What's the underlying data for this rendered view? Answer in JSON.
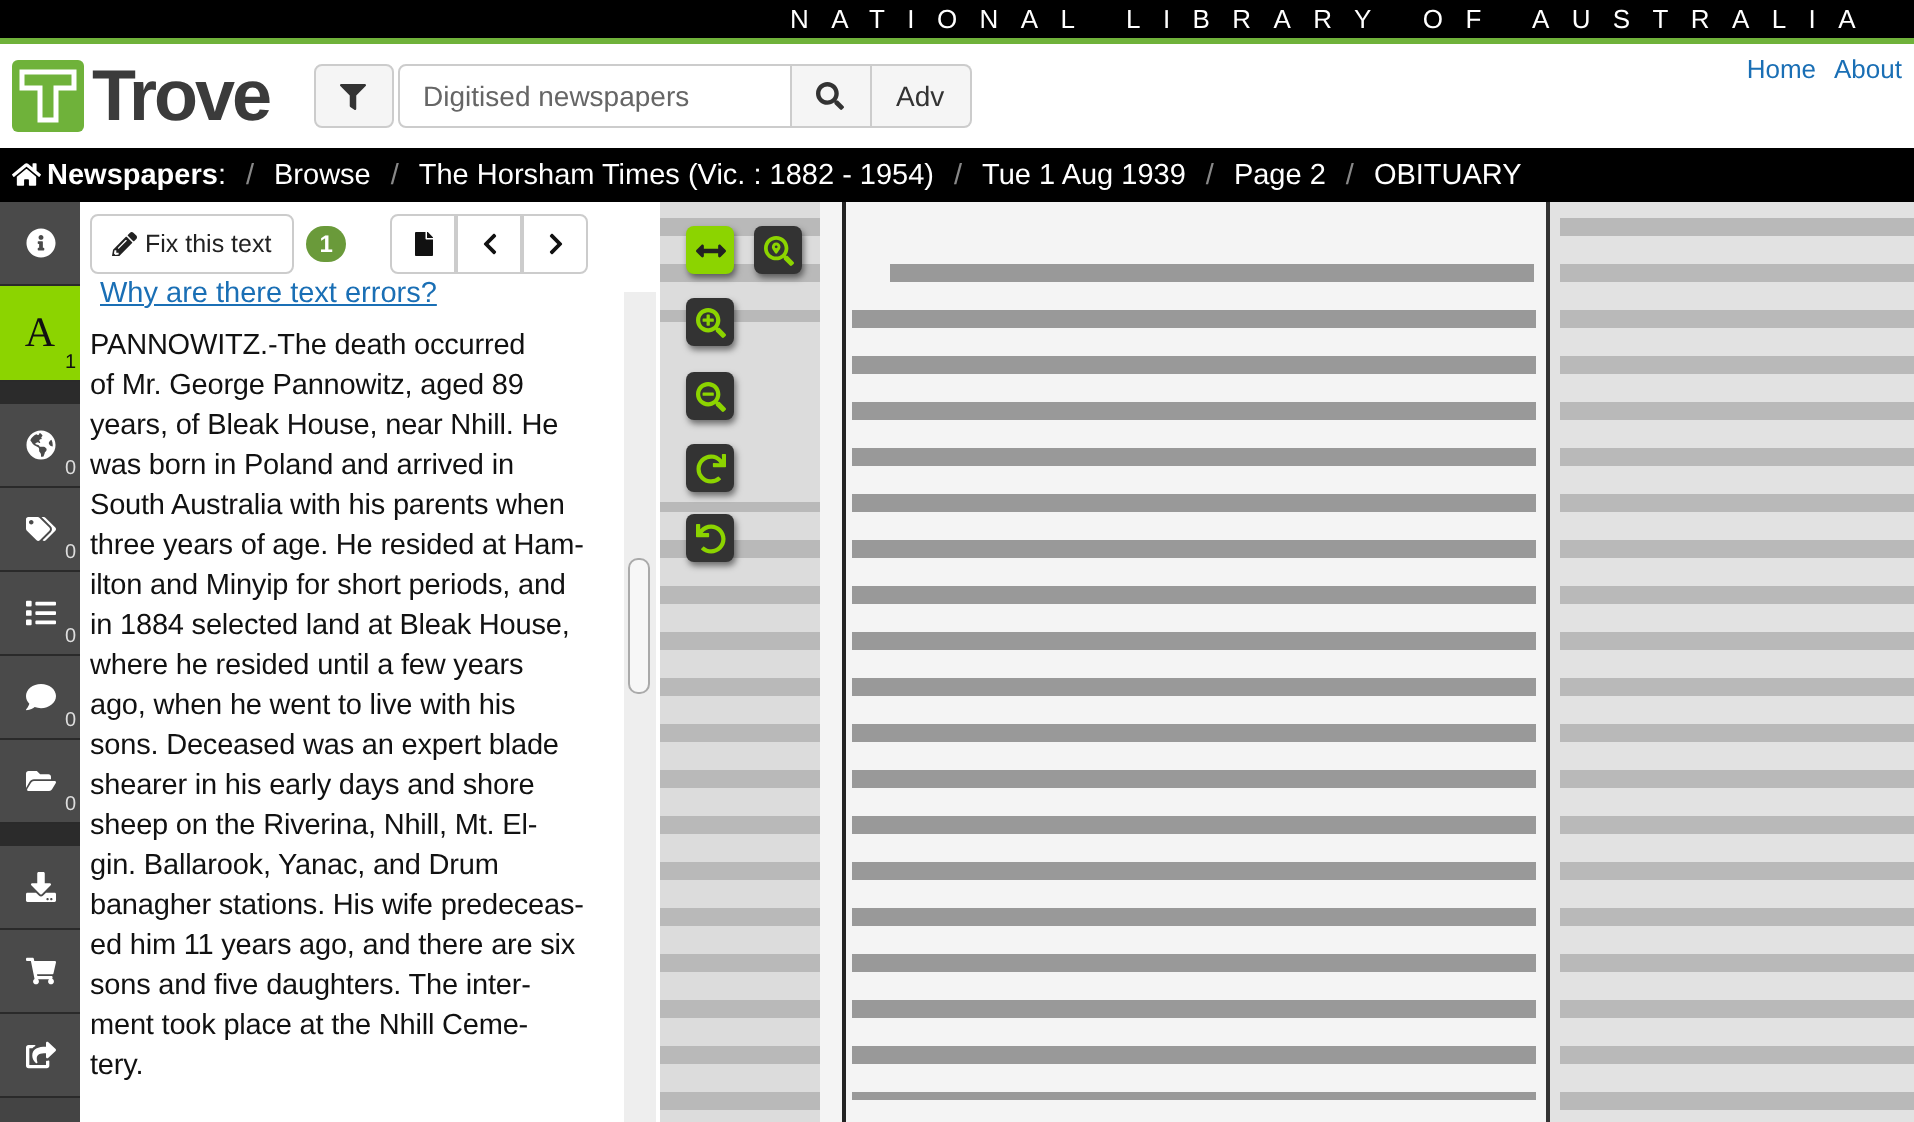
{
  "top_bar": {
    "title": "NATIONAL LIBRARY OF AUSTRALIA"
  },
  "header": {
    "logo_text": "Trove",
    "search": {
      "placeholder": "Digitised newspapers",
      "advanced_label": "Adv"
    },
    "links": [
      "Home",
      "About"
    ]
  },
  "breadcrumb": {
    "root": "Newspapers",
    "root_suffix": ":",
    "separator": "/",
    "items": [
      "Browse",
      "The Horsham Times (Vic. : 1882 - 1954)",
      "Tue 1 Aug 1939",
      "Page 2",
      "OBITUARY"
    ]
  },
  "sidebar": [
    {
      "kind": "tool",
      "selected": false
    },
    {
      "kind": "tool",
      "selected": true,
      "label": "A",
      "count": "1"
    },
    {
      "kind": "separator"
    },
    {
      "kind": "tool",
      "selected": false,
      "count": "0"
    },
    {
      "kind": "tool",
      "selected": false,
      "count": "0"
    },
    {
      "kind": "tool",
      "selected": false,
      "count": "0"
    },
    {
      "kind": "tool",
      "selected": false,
      "count": "0"
    },
    {
      "kind": "tool",
      "selected": false,
      "count": "0"
    },
    {
      "kind": "separator"
    },
    {
      "kind": "tool",
      "selected": false
    },
    {
      "kind": "tool",
      "selected": false
    },
    {
      "kind": "tool",
      "selected": false
    }
  ],
  "text_panel": {
    "fix_button": "Fix this text",
    "correction_count": "1",
    "help_link": "Why are there text errors?",
    "article_lines": [
      "PANNOWITZ.-The death occurred",
      "of Mr. George Pannowitz, aged 89",
      "years, of Bleak House, near Nhill. He",
      "was born in Poland and arrived in",
      "South Australia with his parents when",
      "three years of age. He resided at Ham-",
      "ilton and Minyip for short periods, and",
      "in 1884 selected land at Bleak House,",
      "where he resided until a few years",
      "ago, when he went to live with his",
      "sons. Deceased was an expert blade",
      "shearer in his early days and shore",
      "sheep on the Riverina, Nhill, Mt. El-",
      "gin. Ballarook, Yanac, and Drum",
      "banagher stations. His wife predeceas-",
      "ed him 11 years ago, and there are six",
      "sons and five daughters. The inter-",
      "ment took place at the Nhill Ceme-",
      "tery."
    ]
  },
  "viewer": {
    "tools": [
      {
        "selected": true
      },
      {
        "selected": false
      },
      {
        "selected": false
      },
      {
        "selected": false
      },
      {
        "selected": false
      },
      {
        "selected": false
      }
    ]
  }
}
